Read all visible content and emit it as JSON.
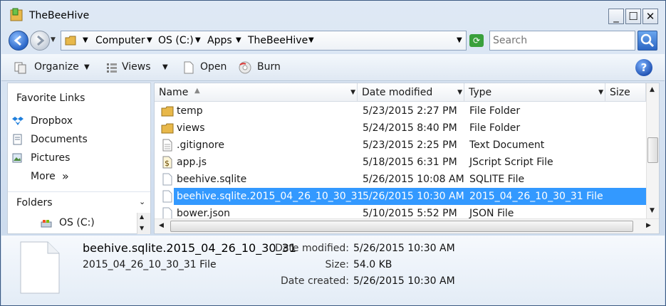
{
  "window": {
    "title": "TheBeeHive"
  },
  "address": {
    "crumbs": [
      "Computer",
      "OS (C:)",
      "Apps",
      "TheBeeHive"
    ],
    "search_placeholder": "Search"
  },
  "toolbar": {
    "organize": "Organize",
    "views": "Views",
    "open": "Open",
    "burn": "Burn"
  },
  "navpane": {
    "favorites_heading": "Favorite Links",
    "links": [
      "Dropbox",
      "Documents",
      "Pictures"
    ],
    "more": "More",
    "more_chevron": "»",
    "folders_heading": "Folders",
    "tree_item": "OS (C:)"
  },
  "filelist": {
    "columns": [
      "Name",
      "Date modified",
      "Type",
      "Size"
    ],
    "rows": [
      {
        "name": "temp",
        "date": "5/23/2015 2:27 PM",
        "type": "File Folder",
        "icon": "folder-icon"
      },
      {
        "name": "views",
        "date": "5/24/2015 8:40 PM",
        "type": "File Folder",
        "icon": "folder-icon"
      },
      {
        "name": ".gitignore",
        "date": "5/23/2015 2:25 PM",
        "type": "Text Document",
        "icon": "text-file-icon"
      },
      {
        "name": "app.js",
        "date": "5/18/2015 6:31 PM",
        "type": "JScript Script File",
        "icon": "script-file-icon"
      },
      {
        "name": "beehive.sqlite",
        "date": "5/26/2015 10:08 AM",
        "type": "SQLITE File",
        "icon": "file-icon"
      },
      {
        "name": "beehive.sqlite.2015_04_26_10_30_31",
        "date": "5/26/2015 10:30 AM",
        "type": "2015_04_26_10_30_31 File",
        "icon": "file-icon"
      },
      {
        "name": "bower.json",
        "date": "5/10/2015 5:52 PM",
        "type": "JSON File",
        "icon": "file-icon"
      }
    ],
    "selected_index": 5
  },
  "details": {
    "name": "beehive.sqlite.2015_04_26_10_30_31",
    "type": "2015_04_26_10_30_31 File",
    "date_modified_label": "Date modified:",
    "date_modified": "5/26/2015 10:30 AM",
    "size_label": "Size:",
    "size": "54.0 KB",
    "date_created_label": "Date created:",
    "date_created": "5/26/2015 10:30 AM"
  },
  "colors": {
    "selection": "#3399ff",
    "folder": "#e8b84a"
  }
}
